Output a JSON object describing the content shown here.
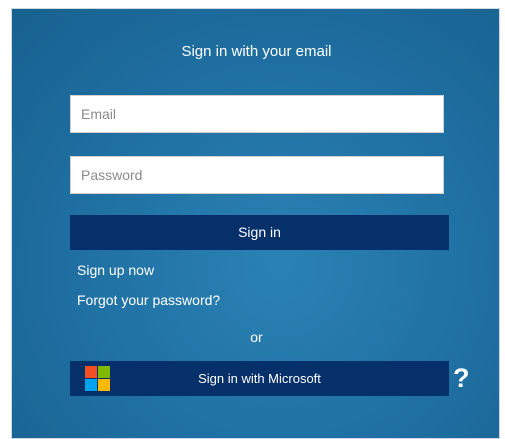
{
  "signin": {
    "title": "Sign in with your email",
    "email_placeholder": "Email",
    "password_placeholder": "Password",
    "signin_button": "Sign in",
    "signup_link": "Sign up now",
    "forgot_link": "Forgot your password?",
    "or_text": "or",
    "microsoft_button": "Sign in with Microsoft",
    "help_icon": "question-mark-icon",
    "help_glyph": "?"
  },
  "colors": {
    "background": "#1f6fa2",
    "button": "#06306a",
    "text": "#ffffff",
    "ms_red": "#f25022",
    "ms_green": "#7fba00",
    "ms_blue": "#00a4ef",
    "ms_yellow": "#ffb900"
  }
}
